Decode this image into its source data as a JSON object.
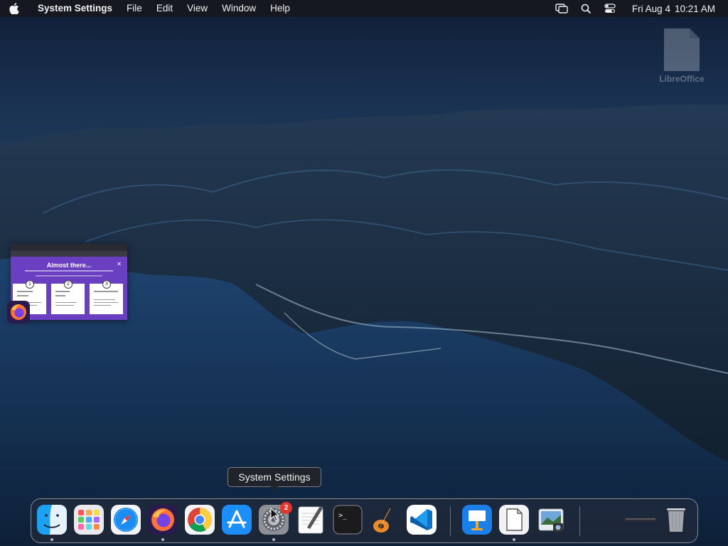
{
  "menubar": {
    "app_name": "System Settings",
    "menus": [
      "File",
      "Edit",
      "View",
      "Window",
      "Help"
    ],
    "clock_date": "Fri Aug 4",
    "clock_time": "10:21 AM",
    "icons": [
      "screen-mirroring-icon",
      "spotlight-search-icon",
      "control-center-icon"
    ]
  },
  "desktop": {
    "icons": [
      {
        "label": "LibreOffice",
        "icon": "libreoffice-icon"
      }
    ]
  },
  "window_thumbnail": {
    "app": "firefox",
    "title": "Almost there...",
    "steps": [
      "1",
      "2",
      "3"
    ]
  },
  "tooltip": {
    "text": "System Settings"
  },
  "dock": {
    "items": [
      {
        "name": "Finder",
        "icon": "finder-icon",
        "running": true
      },
      {
        "name": "Launchpad",
        "icon": "launchpad-icon",
        "running": false
      },
      {
        "name": "Safari",
        "icon": "safari-icon",
        "running": false
      },
      {
        "name": "Firefox",
        "icon": "firefox-icon",
        "running": true
      },
      {
        "name": "Google Chrome",
        "icon": "chrome-icon",
        "running": false
      },
      {
        "name": "App Store",
        "icon": "app-store-icon",
        "running": false
      },
      {
        "name": "System Settings",
        "icon": "system-settings-icon",
        "running": true,
        "badge": "2"
      },
      {
        "name": "TextEdit",
        "icon": "textedit-icon",
        "running": false
      },
      {
        "name": "Terminal",
        "icon": "terminal-icon",
        "running": false
      },
      {
        "name": "GarageBand",
        "icon": "garageband-icon",
        "running": false
      },
      {
        "name": "Visual Studio Code",
        "icon": "vscode-icon",
        "running": false
      },
      {
        "name": "Keynote",
        "icon": "keynote-icon",
        "running": false
      },
      {
        "name": "Document Viewer",
        "icon": "document-icon",
        "running": true
      },
      {
        "name": "Preview",
        "icon": "preview-icon",
        "running": false
      },
      {
        "name": "Minimized Window",
        "icon": "minimized-window-icon",
        "running": false
      },
      {
        "name": "Trash",
        "icon": "trash-icon",
        "running": false
      }
    ]
  },
  "colors": {
    "badge": "#e5362c",
    "menubar": "#16181e",
    "thumbnail": "#6a3fc2"
  }
}
